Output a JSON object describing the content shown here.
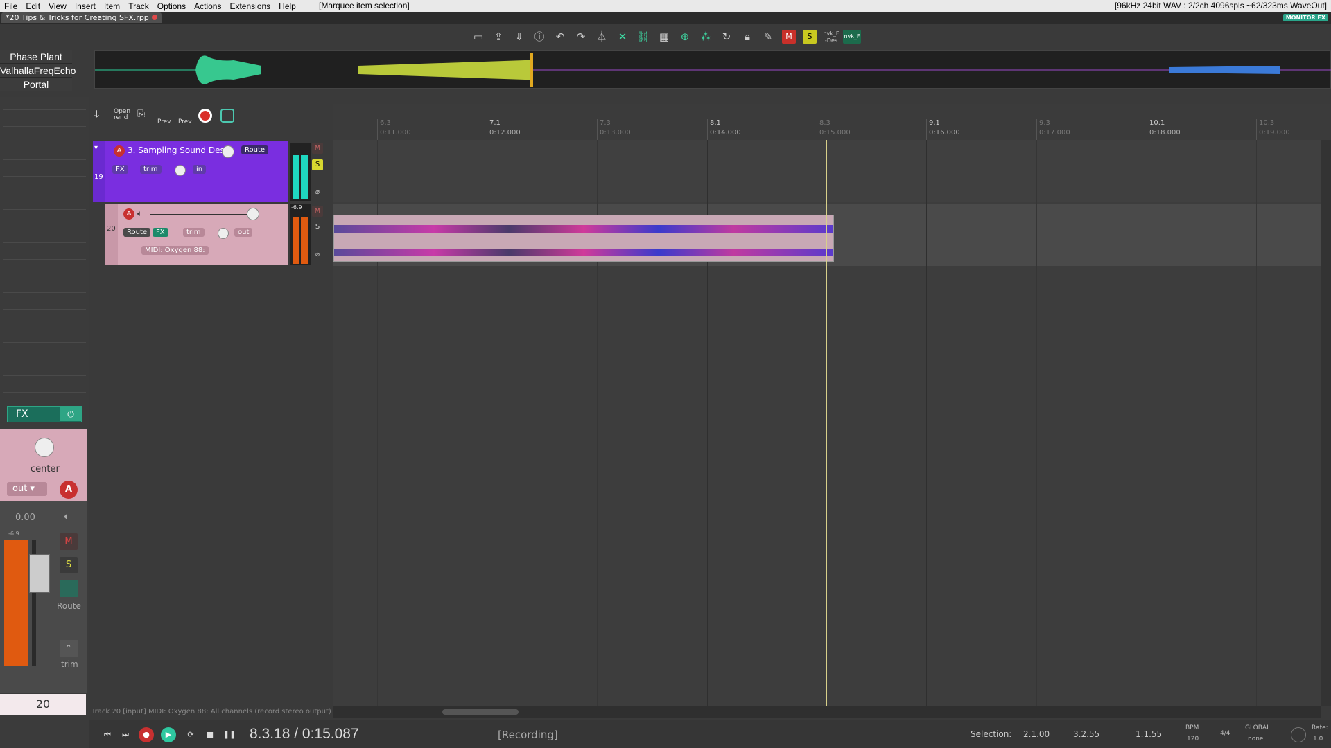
{
  "menu": [
    "File",
    "Edit",
    "View",
    "Insert",
    "Item",
    "Track",
    "Options",
    "Actions",
    "Extensions",
    "Help"
  ],
  "status_text": "[Marquee item selection]",
  "audio_info": "[96kHz 24bit WAV : 2/2ch 4096spls ~62/323ms WaveOut]",
  "project_tab": "*20 Tips & Tricks for Creating  SFX.rpp",
  "monitor_fx": "MONITOR FX",
  "fx_list": [
    "Phase Plant",
    "ValhallaFreqEcho",
    "Portal"
  ],
  "toolbar_icons": [
    "new-file-icon",
    "upload-icon",
    "download-icon",
    "info-icon",
    "undo-icon",
    "redo-icon",
    "metronome-icon",
    "ripple-icon",
    "link-icon",
    "grid-icon",
    "snap-icon",
    "marquee-icon",
    "loop-icon",
    "lock-icon",
    "pencil-icon",
    "m-icon",
    "s-icon",
    "nvk-des-icon",
    "nvk-f-icon"
  ],
  "toolbar_labels": {
    "m": "M",
    "s": "S",
    "nvk1": "nvk_F -Des",
    "nvk2": "nvk_F"
  },
  "subtoolbar": {
    "open_rend": "Open rend",
    "prev1": "Prev",
    "prev2": "Prev"
  },
  "ruler": [
    {
      "bar": "6.3",
      "time": "0:11.000",
      "minor": true
    },
    {
      "bar": "7.1",
      "time": "0:12.000",
      "minor": false
    },
    {
      "bar": "7.3",
      "time": "0:13.000",
      "minor": true
    },
    {
      "bar": "8.1",
      "time": "0:14.000",
      "minor": false
    },
    {
      "bar": "8.3",
      "time": "0:15.000",
      "minor": true
    },
    {
      "bar": "9.1",
      "time": "0:16.000",
      "minor": false
    },
    {
      "bar": "9.3",
      "time": "0:17.000",
      "minor": true
    },
    {
      "bar": "10.1",
      "time": "0:18.000",
      "minor": false
    },
    {
      "bar": "10.3",
      "time": "0:19.000",
      "minor": true
    }
  ],
  "track19": {
    "num": "19",
    "name": "3. Sampling Sound Desig",
    "route": "Route",
    "fx": "FX",
    "trim": "trim",
    "in": "in",
    "m": "M",
    "s": "S"
  },
  "track20": {
    "num": "20",
    "route": "Route",
    "fx": "FX",
    "trim": "trim",
    "out": "out",
    "midi": "MIDI: Oxygen 88:",
    "m": "M",
    "s": "S",
    "peak": "-6.9"
  },
  "mixer": {
    "fx": "FX",
    "pan": "center",
    "out": "out",
    "vol": "0.00",
    "peak": "-6.9",
    "m": "M",
    "s": "S",
    "route": "Route",
    "trim": "trim",
    "track_num": "20"
  },
  "status_line": "Track 20 [input] MIDI: Oxygen 88: All channels (record stereo output)",
  "transport": {
    "time": "8.3.18 / 0:15.087",
    "recording": "[Recording]",
    "selection_label": "Selection:",
    "sel_start": "2.1.00",
    "sel_end": "3.2.55",
    "sel_len": "1.1.55",
    "bpm_label": "BPM",
    "bpm": "120",
    "timesig": "4/4",
    "global": "GLOBAL",
    "none": "none",
    "rate_label": "Rate:",
    "rate": "1.0"
  }
}
